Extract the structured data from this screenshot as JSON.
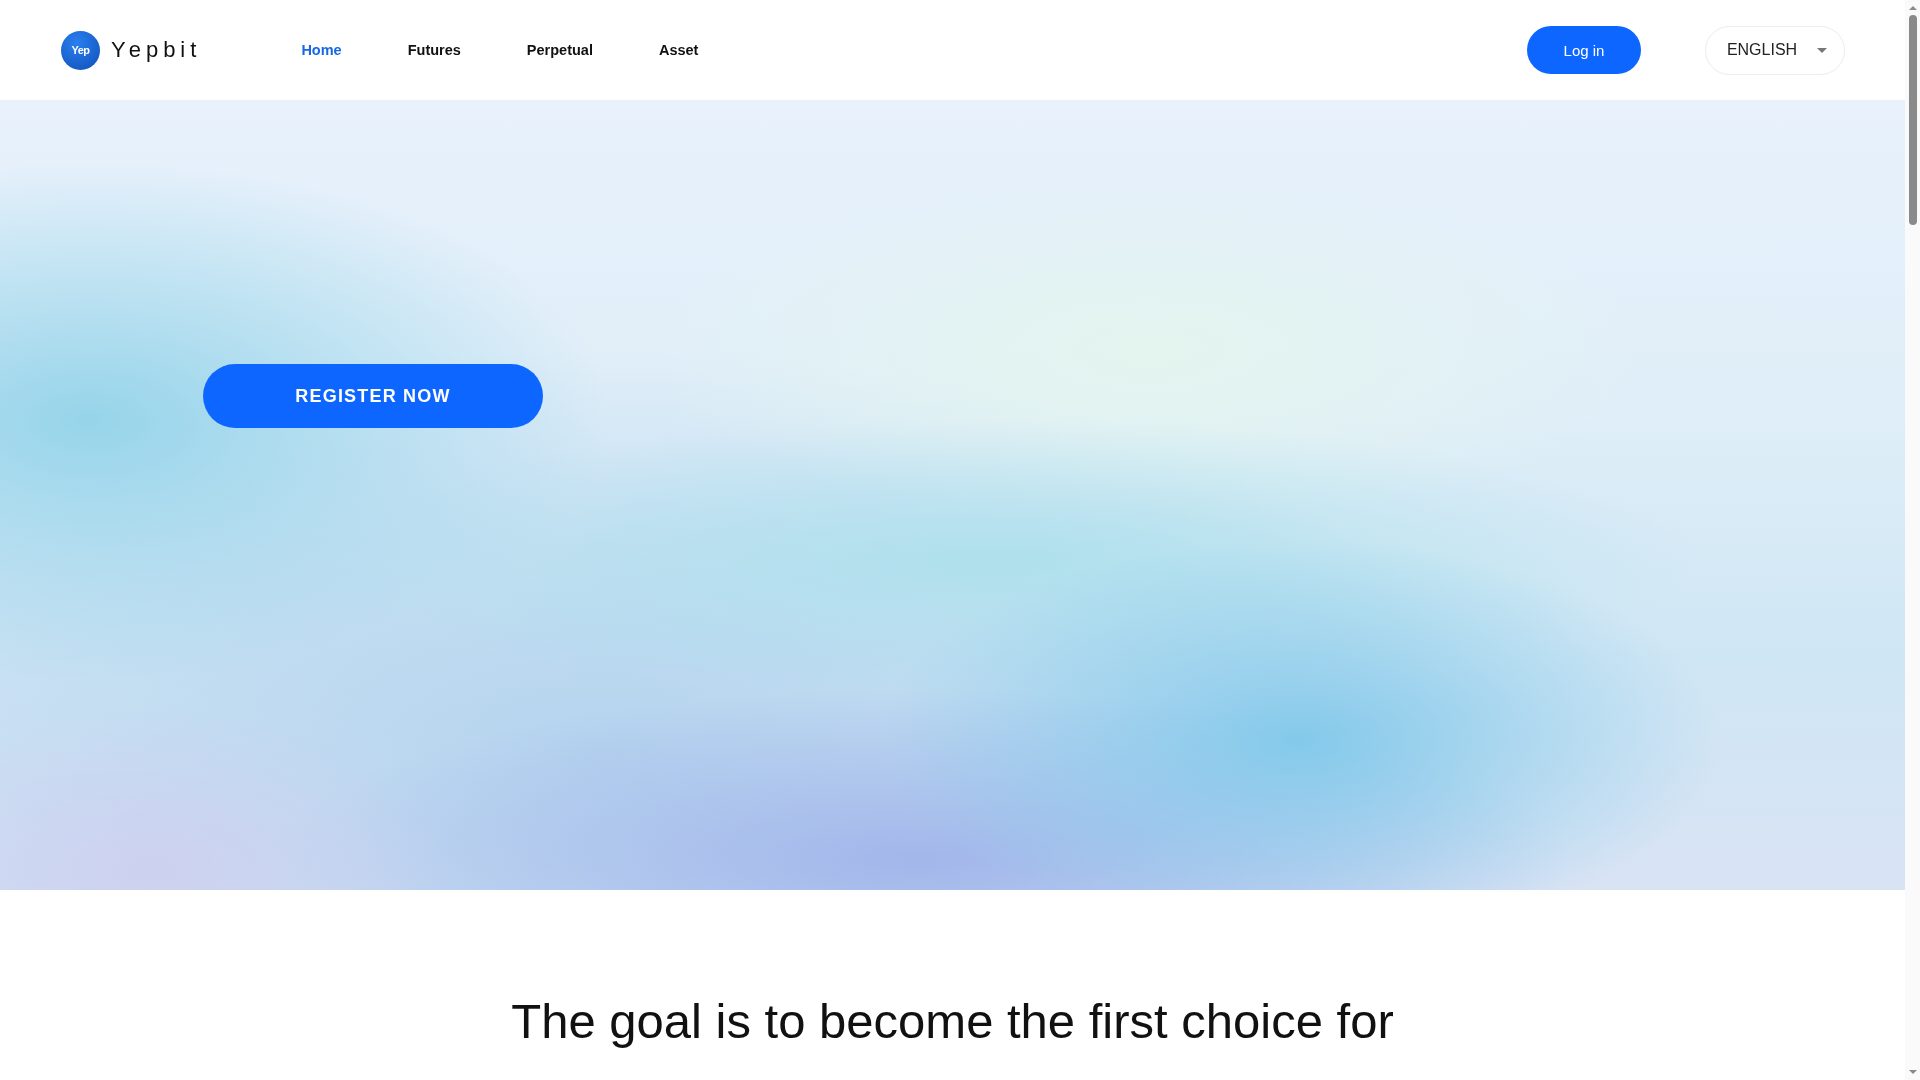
{
  "header": {
    "logo": {
      "mark": "Yep",
      "name": "Yepbit"
    },
    "nav": [
      {
        "label": "Home",
        "selected": true
      },
      {
        "label": "Futures",
        "selected": false
      },
      {
        "label": "Perpetual",
        "selected": false
      },
      {
        "label": "Asset",
        "selected": false
      }
    ],
    "login_button": "Log in",
    "language": {
      "value": "ENGLISH"
    }
  },
  "hero": {
    "cta": "REGISTER NOW"
  },
  "mission": {
    "heading": "The goal is to become the first choice for"
  }
}
